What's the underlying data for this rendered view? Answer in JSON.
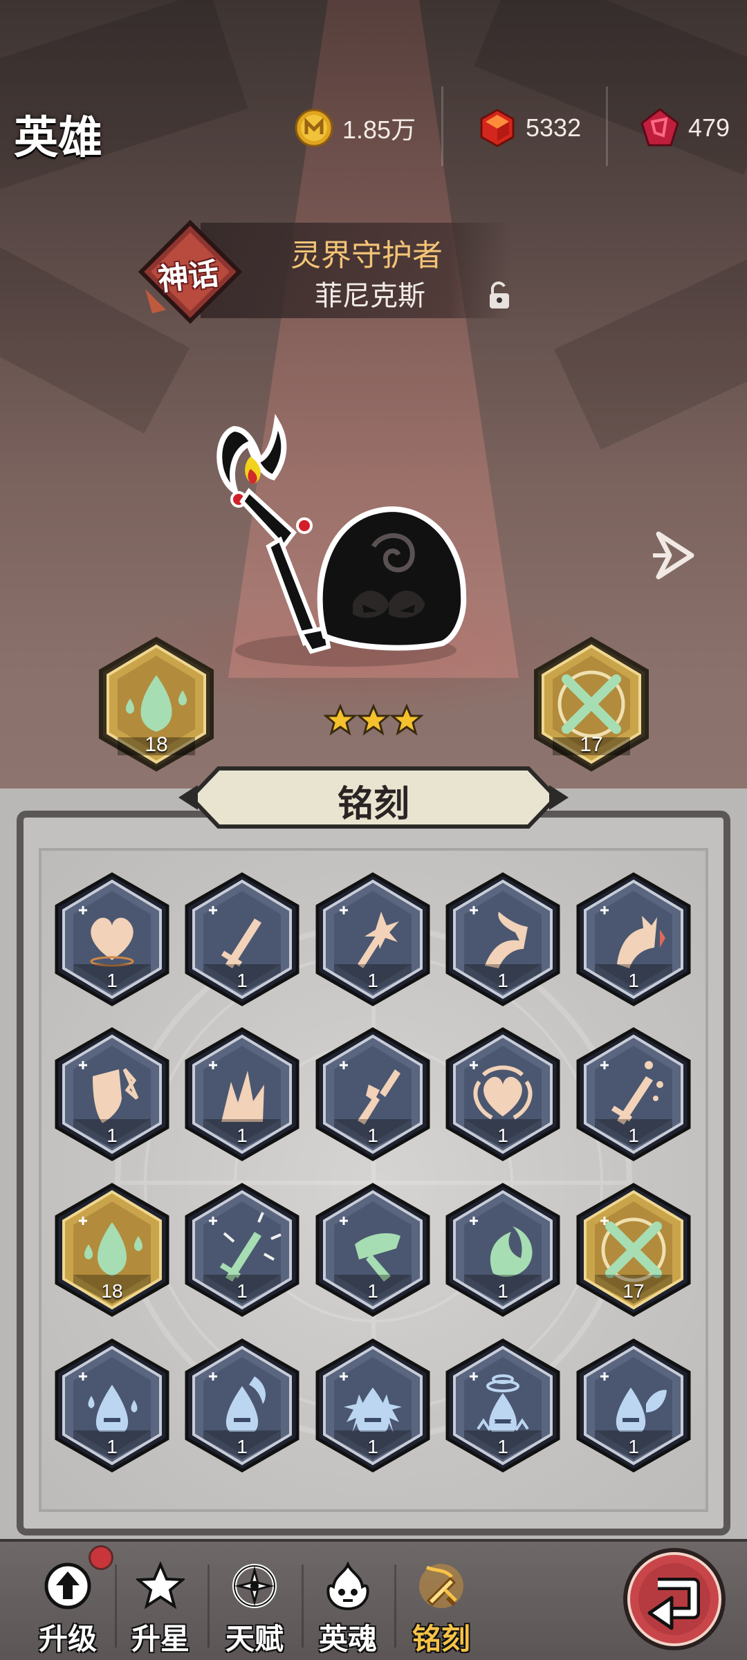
{
  "header": {
    "title": "英雄",
    "currencies": [
      {
        "icon": "gold-coin-icon",
        "value": "1.85万"
      },
      {
        "icon": "red-gem-icon",
        "value": "5332"
      },
      {
        "icon": "crimson-rune-icon",
        "value": "479"
      }
    ]
  },
  "hero": {
    "rarity": "神话",
    "title": "灵界守护者",
    "name": "菲尼克斯",
    "stars": 3,
    "left_equip_level": "18",
    "right_equip_level": "17"
  },
  "panel": {
    "tab_label": "铭刻",
    "runes": [
      {
        "icon": "heart-plus-rune-icon",
        "level": "1"
      },
      {
        "icon": "sword-plus-rune-icon",
        "level": "1"
      },
      {
        "icon": "crit-burst-rune-icon",
        "level": "1"
      },
      {
        "icon": "claw-strike-rune-icon",
        "level": "1"
      },
      {
        "icon": "fist-strike-rune-icon",
        "level": "1"
      },
      {
        "icon": "shield-plus-rune-icon",
        "level": "1"
      },
      {
        "icon": "spike-plus-rune-icon",
        "level": "1"
      },
      {
        "icon": "broken-sword-rune-icon",
        "level": "1"
      },
      {
        "icon": "heart-wings-rune-icon",
        "level": "1"
      },
      {
        "icon": "sword-drops-rune-icon",
        "level": "1"
      },
      {
        "icon": "water-drop-rune-icon",
        "level": "18"
      },
      {
        "icon": "glowing-sword-rune-icon",
        "level": "1"
      },
      {
        "icon": "axe-slash-rune-icon",
        "level": "1"
      },
      {
        "icon": "crescent-slash-rune-icon",
        "level": "1"
      },
      {
        "icon": "crossed-swords-rune-icon",
        "level": "17"
      },
      {
        "icon": "potion-drops-rune-icon",
        "level": "1"
      },
      {
        "icon": "potion-flame-rune-icon",
        "level": "1"
      },
      {
        "icon": "potion-spikes-rune-icon",
        "level": "1"
      },
      {
        "icon": "potion-whirl-rune-icon",
        "level": "1"
      },
      {
        "icon": "potion-leaf-rune-icon",
        "level": "1"
      }
    ]
  },
  "nav": {
    "items": [
      {
        "label": "升级",
        "icon": "upgrade-arrow-icon"
      },
      {
        "label": "升星",
        "icon": "star-icon"
      },
      {
        "label": "天赋",
        "icon": "talent-compass-icon"
      },
      {
        "label": "英魂",
        "icon": "soul-flame-icon"
      },
      {
        "label": "铭刻",
        "icon": "inscription-sword-icon"
      }
    ],
    "active": "铭刻"
  },
  "colors": {
    "gold_accent": "#f6c347",
    "hero_title": "#f3c476",
    "rune_steel": "#4b5770",
    "rune_gold": "#c9a44a",
    "back_button": "#c8464a"
  }
}
